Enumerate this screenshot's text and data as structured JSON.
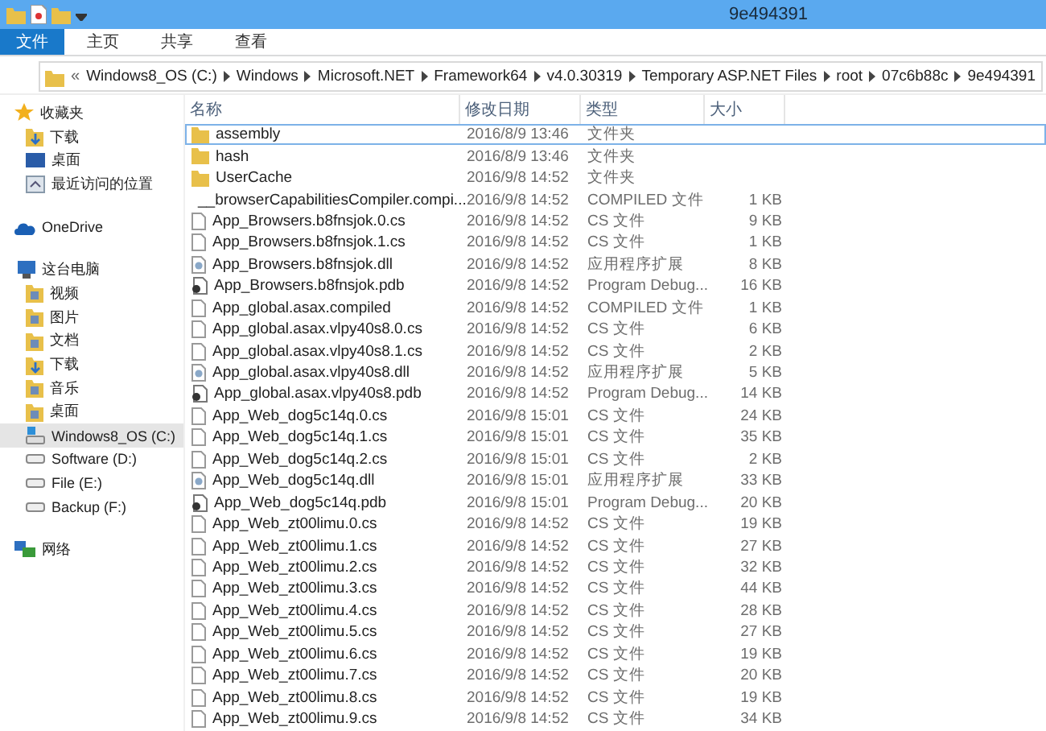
{
  "window": {
    "title": "9e494391"
  },
  "ribbon_tabs": [
    {
      "label": "文件",
      "kind": "file"
    },
    {
      "label": "主页",
      "kind": "tab"
    },
    {
      "label": "共享",
      "kind": "tab"
    },
    {
      "label": "查看",
      "kind": "tab"
    }
  ],
  "address_bar": {
    "overflow": "«",
    "segments": [
      "Windows8_OS (C:)",
      "Windows",
      "Microsoft.NET",
      "Framework64",
      "v4.0.30319",
      "Temporary ASP.NET Files",
      "root",
      "07c6b88c",
      "9e494391"
    ]
  },
  "sidebar": {
    "groups": [
      {
        "label": "收藏夹",
        "kind": "star",
        "items": [
          {
            "label": "下载",
            "kind": "download",
            "selected": false
          },
          {
            "label": "桌面",
            "kind": "desktop",
            "selected": false
          },
          {
            "label": "最近访问的位置",
            "kind": "recent",
            "selected": false
          }
        ]
      },
      {
        "label": "OneDrive",
        "kind": "cloud"
      },
      {
        "label": "这台电脑",
        "kind": "pc",
        "items": [
          {
            "label": "视频",
            "kind": "folder",
            "selected": false
          },
          {
            "label": "图片",
            "kind": "folder",
            "selected": false
          },
          {
            "label": "文档",
            "kind": "folder",
            "selected": false
          },
          {
            "label": "下载",
            "kind": "download",
            "selected": false
          },
          {
            "label": "音乐",
            "kind": "folder",
            "selected": false
          },
          {
            "label": "桌面",
            "kind": "folder",
            "selected": false
          },
          {
            "label": "Windows8_OS (C:)",
            "kind": "osdrive",
            "selected": true
          },
          {
            "label": "Software (D:)",
            "kind": "drive",
            "selected": false
          },
          {
            "label": "File (E:)",
            "kind": "drive",
            "selected": false
          },
          {
            "label": "Backup (F:)",
            "kind": "drive",
            "selected": false
          }
        ]
      },
      {
        "label": "网络",
        "kind": "network"
      }
    ]
  },
  "table": {
    "columns": [
      "名称",
      "修改日期",
      "类型",
      "大小"
    ],
    "rows": [
      {
        "kind": "folder",
        "name": "assembly",
        "date": "2016/8/9 13:46",
        "type": "文件夹",
        "size": "",
        "selected": true
      },
      {
        "kind": "folder",
        "name": "hash",
        "date": "2016/8/9 13:46",
        "type": "文件夹",
        "size": "",
        "selected": false
      },
      {
        "kind": "folder",
        "name": "UserCache",
        "date": "2016/9/8 14:52",
        "type": "文件夹",
        "size": "",
        "selected": false
      },
      {
        "kind": "file",
        "name": "__browserCapabilitiesCompiler.compi...",
        "date": "2016/9/8 14:52",
        "type": "COMPILED 文件",
        "size": "1 KB",
        "selected": false
      },
      {
        "kind": "file",
        "name": "App_Browsers.b8fnsjok.0.cs",
        "date": "2016/9/8 14:52",
        "type": "CS 文件",
        "size": "9 KB",
        "selected": false
      },
      {
        "kind": "file",
        "name": "App_Browsers.b8fnsjok.1.cs",
        "date": "2016/9/8 14:52",
        "type": "CS 文件",
        "size": "1 KB",
        "selected": false
      },
      {
        "kind": "dll",
        "name": "App_Browsers.b8fnsjok.dll",
        "date": "2016/9/8 14:52",
        "type": "应用程序扩展",
        "size": "8 KB",
        "selected": false
      },
      {
        "kind": "pdb",
        "name": "App_Browsers.b8fnsjok.pdb",
        "date": "2016/9/8 14:52",
        "type": "Program Debug...",
        "size": "16 KB",
        "selected": false
      },
      {
        "kind": "file",
        "name": "App_global.asax.compiled",
        "date": "2016/9/8 14:52",
        "type": "COMPILED 文件",
        "size": "1 KB",
        "selected": false
      },
      {
        "kind": "file",
        "name": "App_global.asax.vlpy40s8.0.cs",
        "date": "2016/9/8 14:52",
        "type": "CS 文件",
        "size": "6 KB",
        "selected": false
      },
      {
        "kind": "file",
        "name": "App_global.asax.vlpy40s8.1.cs",
        "date": "2016/9/8 14:52",
        "type": "CS 文件",
        "size": "2 KB",
        "selected": false
      },
      {
        "kind": "dll",
        "name": "App_global.asax.vlpy40s8.dll",
        "date": "2016/9/8 14:52",
        "type": "应用程序扩展",
        "size": "5 KB",
        "selected": false
      },
      {
        "kind": "pdb",
        "name": "App_global.asax.vlpy40s8.pdb",
        "date": "2016/9/8 14:52",
        "type": "Program Debug...",
        "size": "14 KB",
        "selected": false
      },
      {
        "kind": "file",
        "name": "App_Web_dog5c14q.0.cs",
        "date": "2016/9/8 15:01",
        "type": "CS 文件",
        "size": "24 KB",
        "selected": false
      },
      {
        "kind": "file",
        "name": "App_Web_dog5c14q.1.cs",
        "date": "2016/9/8 15:01",
        "type": "CS 文件",
        "size": "35 KB",
        "selected": false
      },
      {
        "kind": "file",
        "name": "App_Web_dog5c14q.2.cs",
        "date": "2016/9/8 15:01",
        "type": "CS 文件",
        "size": "2 KB",
        "selected": false
      },
      {
        "kind": "dll",
        "name": "App_Web_dog5c14q.dll",
        "date": "2016/9/8 15:01",
        "type": "应用程序扩展",
        "size": "33 KB",
        "selected": false
      },
      {
        "kind": "pdb",
        "name": "App_Web_dog5c14q.pdb",
        "date": "2016/9/8 15:01",
        "type": "Program Debug...",
        "size": "20 KB",
        "selected": false
      },
      {
        "kind": "file",
        "name": "App_Web_zt00limu.0.cs",
        "date": "2016/9/8 14:52",
        "type": "CS 文件",
        "size": "19 KB",
        "selected": false
      },
      {
        "kind": "file",
        "name": "App_Web_zt00limu.1.cs",
        "date": "2016/9/8 14:52",
        "type": "CS 文件",
        "size": "27 KB",
        "selected": false
      },
      {
        "kind": "file",
        "name": "App_Web_zt00limu.2.cs",
        "date": "2016/9/8 14:52",
        "type": "CS 文件",
        "size": "32 KB",
        "selected": false
      },
      {
        "kind": "file",
        "name": "App_Web_zt00limu.3.cs",
        "date": "2016/9/8 14:52",
        "type": "CS 文件",
        "size": "44 KB",
        "selected": false
      },
      {
        "kind": "file",
        "name": "App_Web_zt00limu.4.cs",
        "date": "2016/9/8 14:52",
        "type": "CS 文件",
        "size": "28 KB",
        "selected": false
      },
      {
        "kind": "file",
        "name": "App_Web_zt00limu.5.cs",
        "date": "2016/9/8 14:52",
        "type": "CS 文件",
        "size": "27 KB",
        "selected": false
      },
      {
        "kind": "file",
        "name": "App_Web_zt00limu.6.cs",
        "date": "2016/9/8 14:52",
        "type": "CS 文件",
        "size": "19 KB",
        "selected": false
      },
      {
        "kind": "file",
        "name": "App_Web_zt00limu.7.cs",
        "date": "2016/9/8 14:52",
        "type": "CS 文件",
        "size": "20 KB",
        "selected": false
      },
      {
        "kind": "file",
        "name": "App_Web_zt00limu.8.cs",
        "date": "2016/9/8 14:52",
        "type": "CS 文件",
        "size": "19 KB",
        "selected": false
      },
      {
        "kind": "file",
        "name": "App_Web_zt00limu.9.cs",
        "date": "2016/9/8 14:52",
        "type": "CS 文件",
        "size": "34 KB",
        "selected": false
      }
    ]
  }
}
